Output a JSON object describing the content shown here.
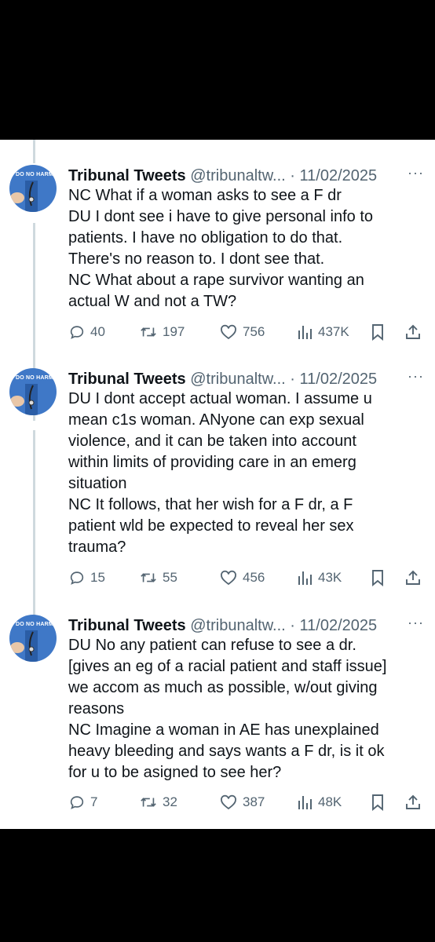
{
  "tweets": [
    {
      "name": "Tribunal Tweets",
      "handle": "@tribunaltw...",
      "separator": "·",
      "date": "11/02/2025",
      "more": "···",
      "avatar_text": "DO NO HARM",
      "lines": [
        "NC  What if a woman asks to see a F dr",
        "DU  I dont see i have to give personal info to",
        "patients. I have no obligation to do that.",
        "There's no reason to. I dont see that.",
        "NC  What about a rape survivor wanting an",
        "actual W and not a TW?"
      ],
      "replies": "40",
      "retweets": "197",
      "likes": "756",
      "views": "437K"
    },
    {
      "name": "Tribunal Tweets",
      "handle": "@tribunaltw...",
      "separator": "·",
      "date": "11/02/2025",
      "more": "···",
      "avatar_text": "DO NO HARM",
      "lines": [
        "DU  I dont accept actual woman. I assume u",
        "mean c1s woman. ANyone can exp sexual",
        "violence, and it can be taken into account",
        "within limits of providing care in an emerg",
        "situation",
        "NC  It follows, that her wish for a F dr, a F",
        "patient wld be expected to reveal her sex",
        "trauma?"
      ],
      "replies": "15",
      "retweets": "55",
      "likes": "456",
      "views": "43K"
    },
    {
      "name": "Tribunal Tweets",
      "handle": "@tribunaltw...",
      "separator": "·",
      "date": "11/02/2025",
      "more": "···",
      "avatar_text": "DO NO HARM",
      "lines": [
        "DU  No any patient can refuse to see a dr.",
        "[gives an eg of a racial patient and staff issue]",
        "we accom as much as possible, w/out giving",
        "reasons",
        "NC  Imagine a woman in AE has unexplained",
        "heavy bleeding and says wants a F dr, is it ok",
        "for u to be asigned to see her?"
      ],
      "replies": "7",
      "retweets": "32",
      "likes": "387",
      "views": "48K"
    }
  ],
  "colors": {
    "background": "#000000",
    "panel": "#ffffff",
    "text": "#0f1419",
    "muted": "#536471",
    "avatar": "#3f78c7",
    "thread_line": "#cfd9de"
  },
  "icons": [
    "reply-icon",
    "retweet-icon",
    "like-icon",
    "views-icon",
    "bookmark-icon",
    "share-icon"
  ]
}
